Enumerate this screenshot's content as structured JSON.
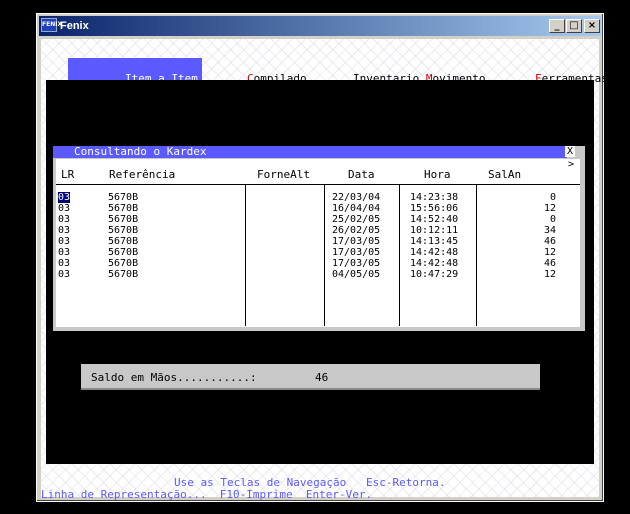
{
  "window": {
    "title": "Fenix",
    "icon_text": "FENIX"
  },
  "menu": {
    "items": [
      {
        "label_pre": "Item a Item",
        "hot": "",
        "label_post": ""
      },
      {
        "label_pre": "",
        "hot": "C",
        "label_post": "ompilado"
      },
      {
        "label_pre": "Inventario ",
        "hot": "M",
        "label_post": "ovimento"
      },
      {
        "label_pre": "",
        "hot": "F",
        "label_post": "erramentas"
      }
    ]
  },
  "dialog": {
    "title": "Consultando o Kardex",
    "close": "X",
    "more": ">",
    "columns": {
      "lr": "LR",
      "referencia": "Referência",
      "fornealt": "ForneAlt",
      "data": "Data",
      "hora": "Hora",
      "salan": "SalAn"
    },
    "rows": [
      {
        "lr": "03",
        "ref": "5670B",
        "data": "22/03/04",
        "hora": "14:23:38",
        "salan": "0"
      },
      {
        "lr": "03",
        "ref": "5670B",
        "data": "16/04/04",
        "hora": "15:56:06",
        "salan": "12"
      },
      {
        "lr": "03",
        "ref": "5670B",
        "data": "25/02/05",
        "hora": "14:52:40",
        "salan": "0"
      },
      {
        "lr": "03",
        "ref": "5670B",
        "data": "26/02/05",
        "hora": "10:12:11",
        "salan": "34"
      },
      {
        "lr": "03",
        "ref": "5670B",
        "data": "17/03/05",
        "hora": "14:13:45",
        "salan": "46"
      },
      {
        "lr": "03",
        "ref": "5670B",
        "data": "17/03/05",
        "hora": "14:42:48",
        "salan": "12"
      },
      {
        "lr": "03",
        "ref": "5670B",
        "data": "17/03/05",
        "hora": "14:42:48",
        "salan": "46"
      },
      {
        "lr": "03",
        "ref": "5670B",
        "data": "04/05/05",
        "hora": "10:47:29",
        "salan": "12"
      }
    ]
  },
  "saldo": {
    "label": "Saldo em Mãos...........:",
    "value": "46"
  },
  "footer": {
    "line1": "Use as Teclas de Navegação   Esc-Retorna.",
    "line2": "Linha de Representação...  F10-Imprime  Enter-Ver."
  }
}
